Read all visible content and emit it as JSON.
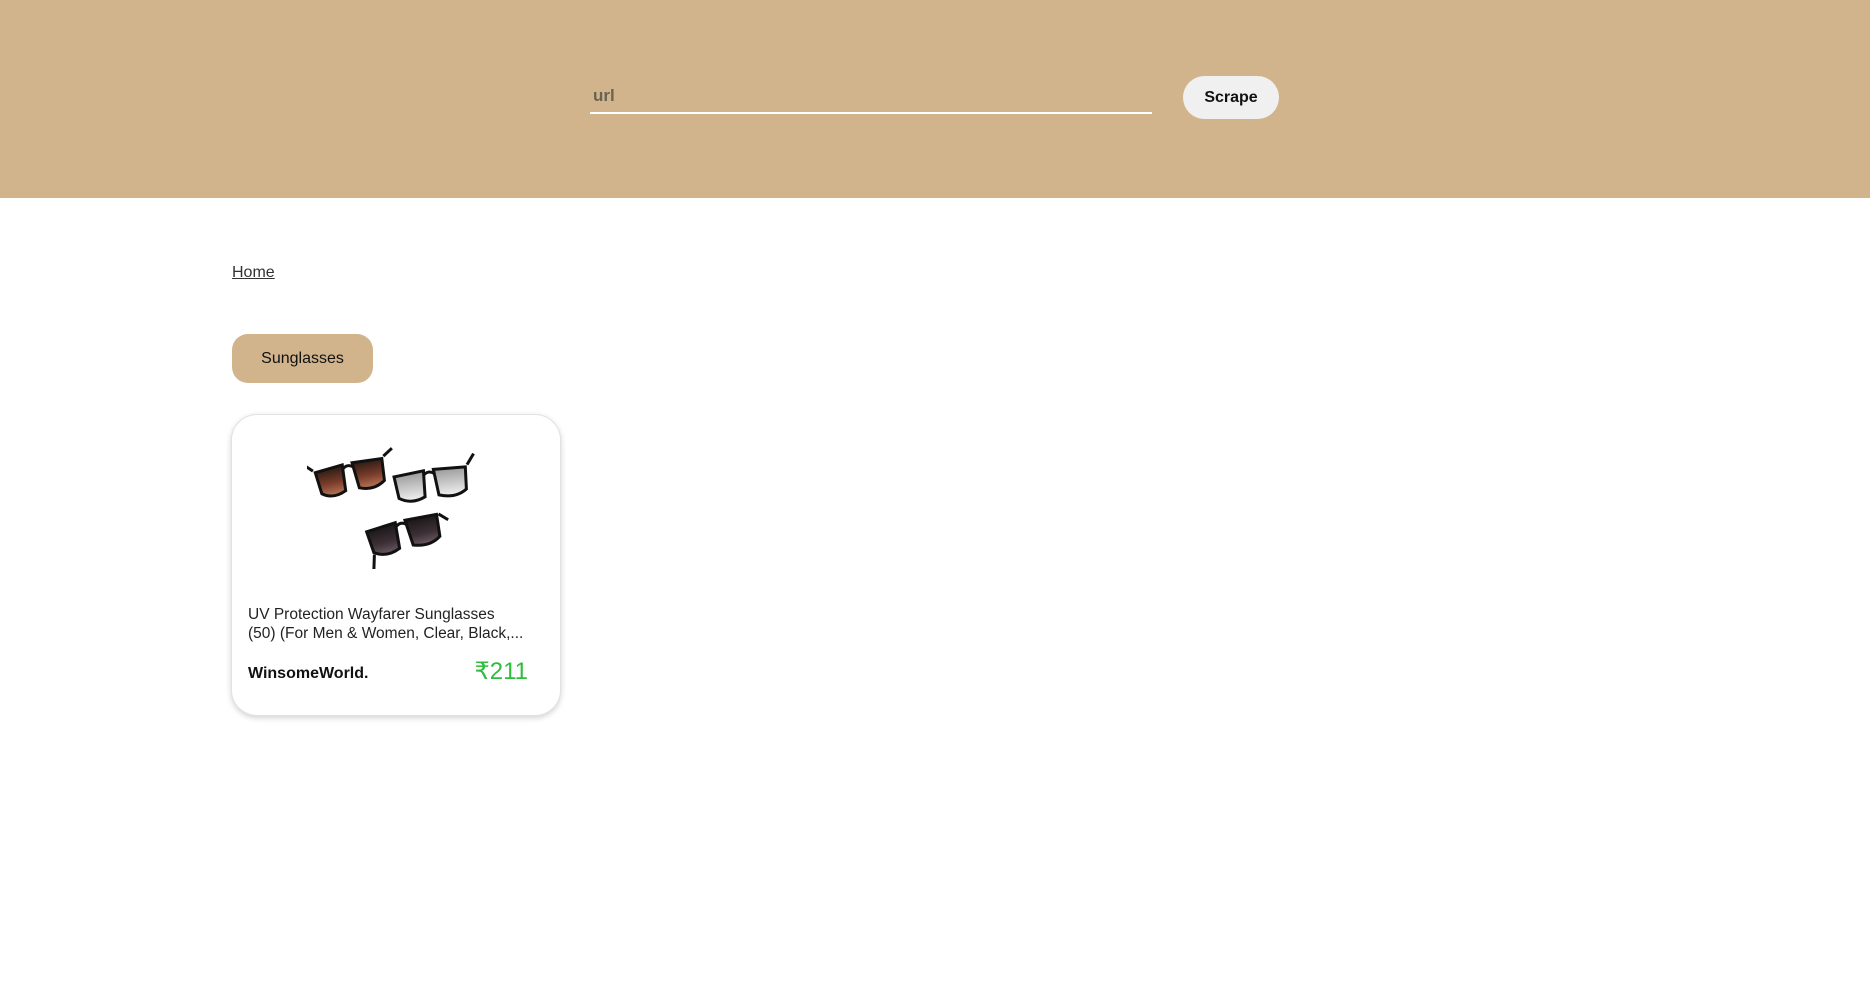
{
  "header": {
    "url_placeholder": "url",
    "url_value": "",
    "scrape_label": "Scrape",
    "background_color": "#d2b48c"
  },
  "breadcrumb": {
    "home_label": "Home"
  },
  "category": {
    "label": "Sunglasses"
  },
  "products": [
    {
      "image_icon": "sunglasses-image",
      "title_line1": "UV Protection Wayfarer Sunglasses",
      "title_line2": "(50)  (For Men & Women, Clear, Black,...",
      "brand": "WinsomeWorld.",
      "price": "₹211",
      "price_color": "#2ebd3d"
    }
  ]
}
